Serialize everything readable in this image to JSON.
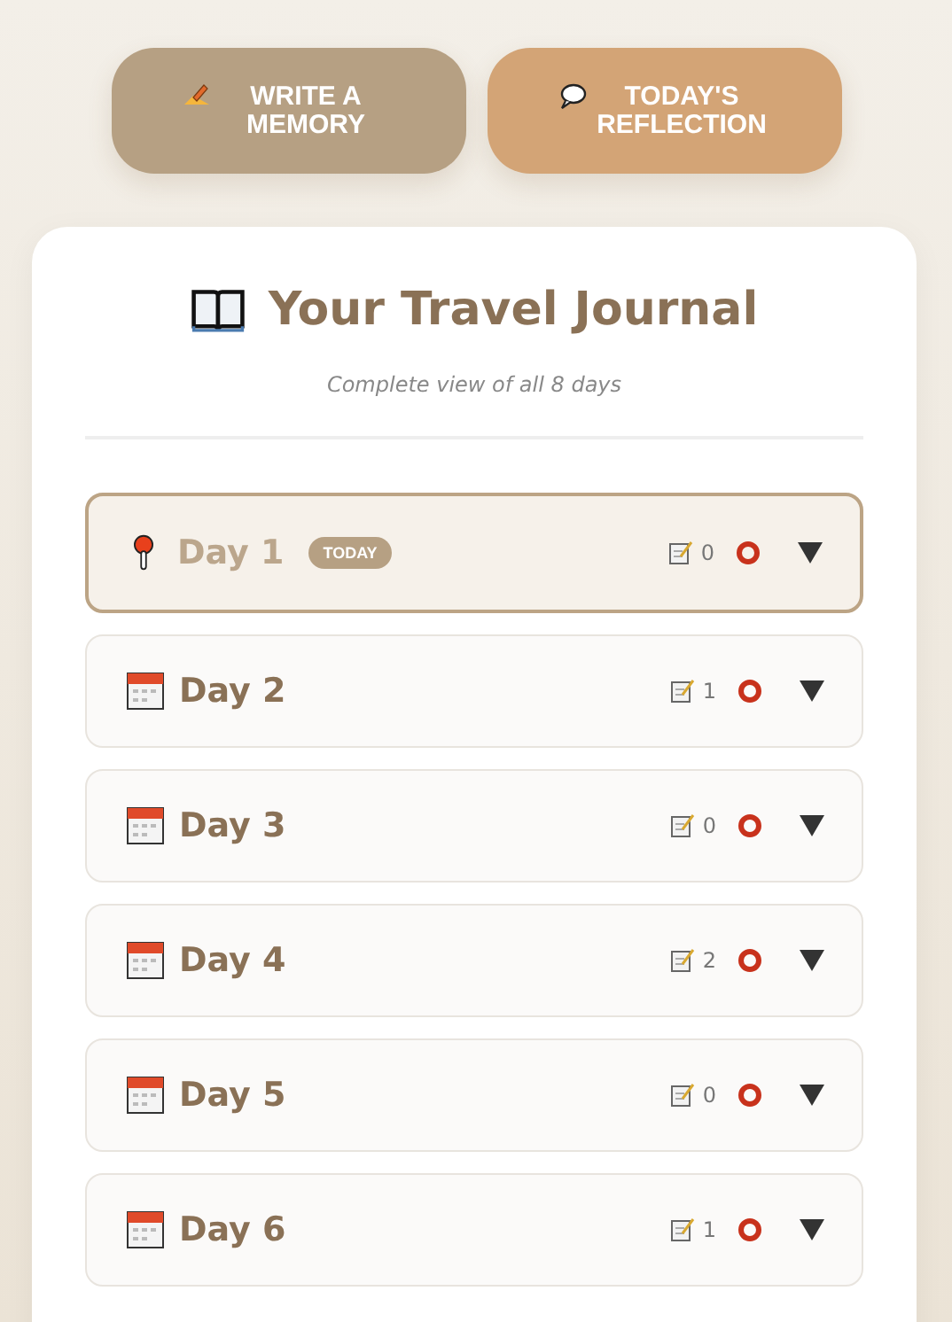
{
  "actions": [
    {
      "kind": "write",
      "label": "WRITE A MEMORY"
    },
    {
      "kind": "reflect",
      "label": "TODAY'S REFLECTION"
    }
  ],
  "journal": {
    "title": "Your Travel Journal",
    "subtitle": "Complete view of all 8 days"
  },
  "days": [
    {
      "label": "Day 1",
      "today": true,
      "badge": "TODAY",
      "count": "0",
      "expanded": false
    },
    {
      "label": "Day 2",
      "today": false,
      "count": "1",
      "expanded": false
    },
    {
      "label": "Day 3",
      "today": false,
      "count": "0",
      "expanded": false
    },
    {
      "label": "Day 4",
      "today": false,
      "count": "2",
      "expanded": false
    },
    {
      "label": "Day 5",
      "today": false,
      "count": "0",
      "expanded": false
    },
    {
      "label": "Day 6",
      "today": false,
      "count": "1",
      "expanded": false
    }
  ]
}
